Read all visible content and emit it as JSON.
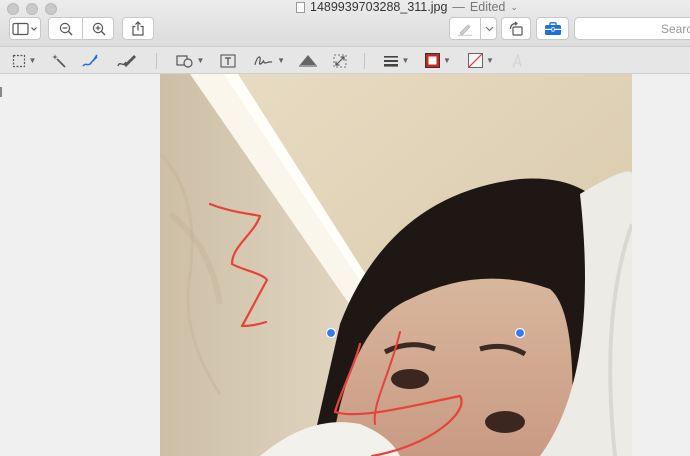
{
  "window": {
    "filename": "1489939703288_311.jpg",
    "separator": "—",
    "edited_label": "Edited",
    "menu_caret": "⌄"
  },
  "toolbar": {
    "search_placeholder": "Search"
  },
  "icons": {
    "sidebar": "sidebar-icon",
    "zoom_out": "zoom-out-icon",
    "zoom_in": "zoom-in-icon",
    "share": "share-icon",
    "highlight": "highlight-pen-icon",
    "rotate": "rotate-left-icon",
    "markup_toolbox": "toolbox-icon"
  },
  "markup_tools": [
    "rectangular-selection-icon",
    "instant-alpha-icon",
    "sketch-icon",
    "draw-icon",
    "shapes-icon",
    "text-icon",
    "sign-icon",
    "adjust-color-icon",
    "adjust-size-icon",
    "shape-style-icon",
    "border-color-icon",
    "fill-color-icon",
    "text-style-icon"
  ],
  "colors": {
    "accent_blue": "#1d6fe0",
    "ink_red": "#e8423a",
    "border_color": "#c8261e",
    "handle_blue": "#2f7cf6"
  }
}
